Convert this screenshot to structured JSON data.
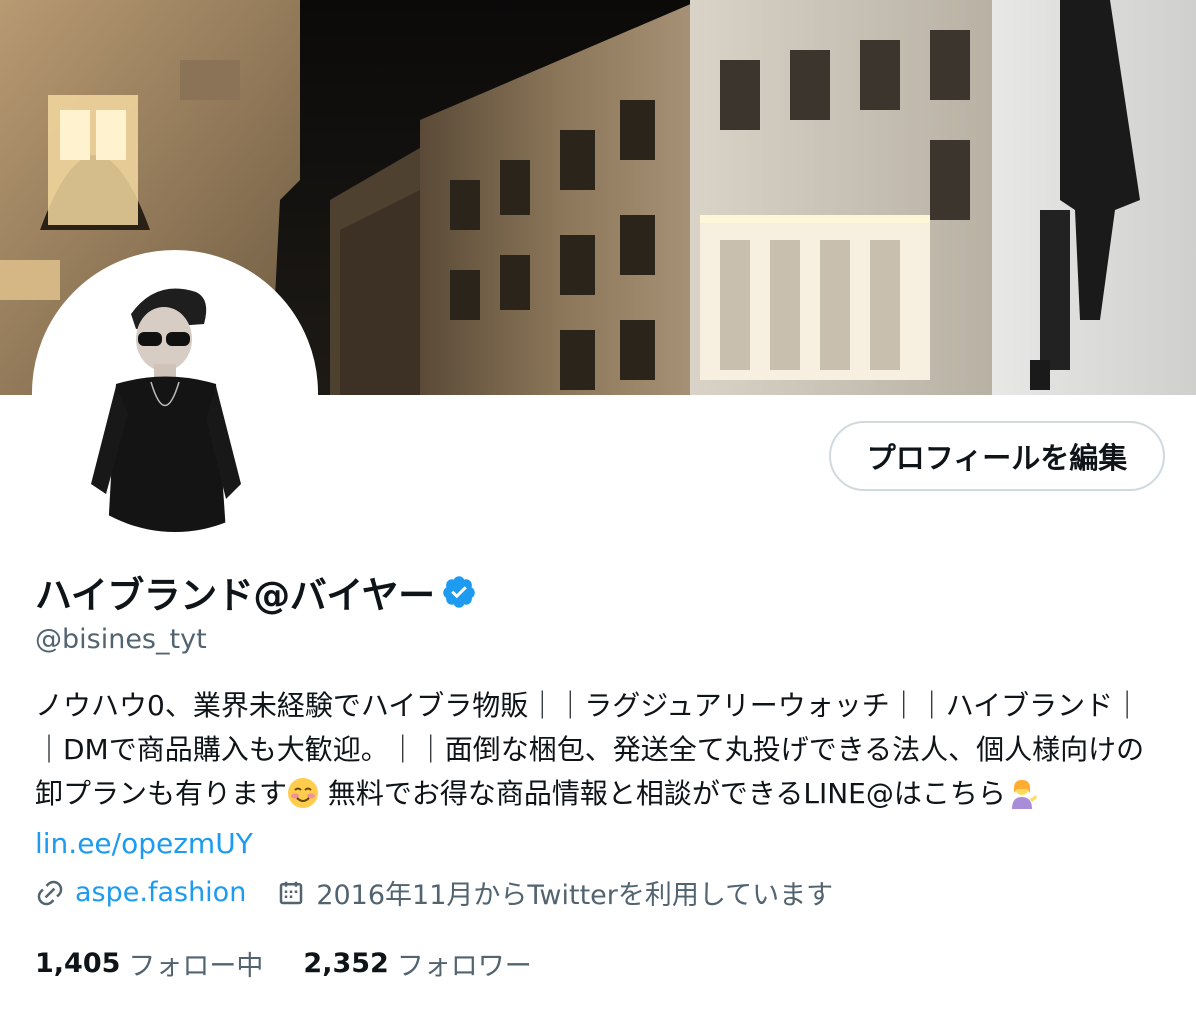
{
  "header": {
    "edit_profile_label": "プロフィールを編集"
  },
  "profile": {
    "display_name": "ハイブランド@バイヤー",
    "handle": "@bisines_tyt",
    "bio_part1": "ノウハウ0、業界未経験でハイブラ物販｜｜ラグジュアリーウォッチ｜｜ハイブランド｜｜DMで商品購入も大歓迎。｜｜面倒な梱包、発送全て丸投げできる法人、個人様向けの卸プランも有ります",
    "bio_part2": " 無料でお得な商品情報と相談ができるLINE@はこちら",
    "bio_link": "lin.ee/opezmUY",
    "website": "aspe.fashion",
    "joined": "2016年11月からTwitterを利用しています"
  },
  "stats": {
    "following_count": "1,405",
    "following_label": "フォロー中",
    "followers_count": "2,352",
    "followers_label": "フォロワー"
  },
  "icons": {
    "verified": "verified-badge-icon",
    "link": "link-icon",
    "calendar": "calendar-icon",
    "smile_emoji": "smiling-face-emoji",
    "person_emoji": "person-tipping-hand-emoji"
  },
  "colors": {
    "accent": "#1d9bf0",
    "text": "#0f1419",
    "secondary": "#536471",
    "border": "#cfd9de"
  }
}
